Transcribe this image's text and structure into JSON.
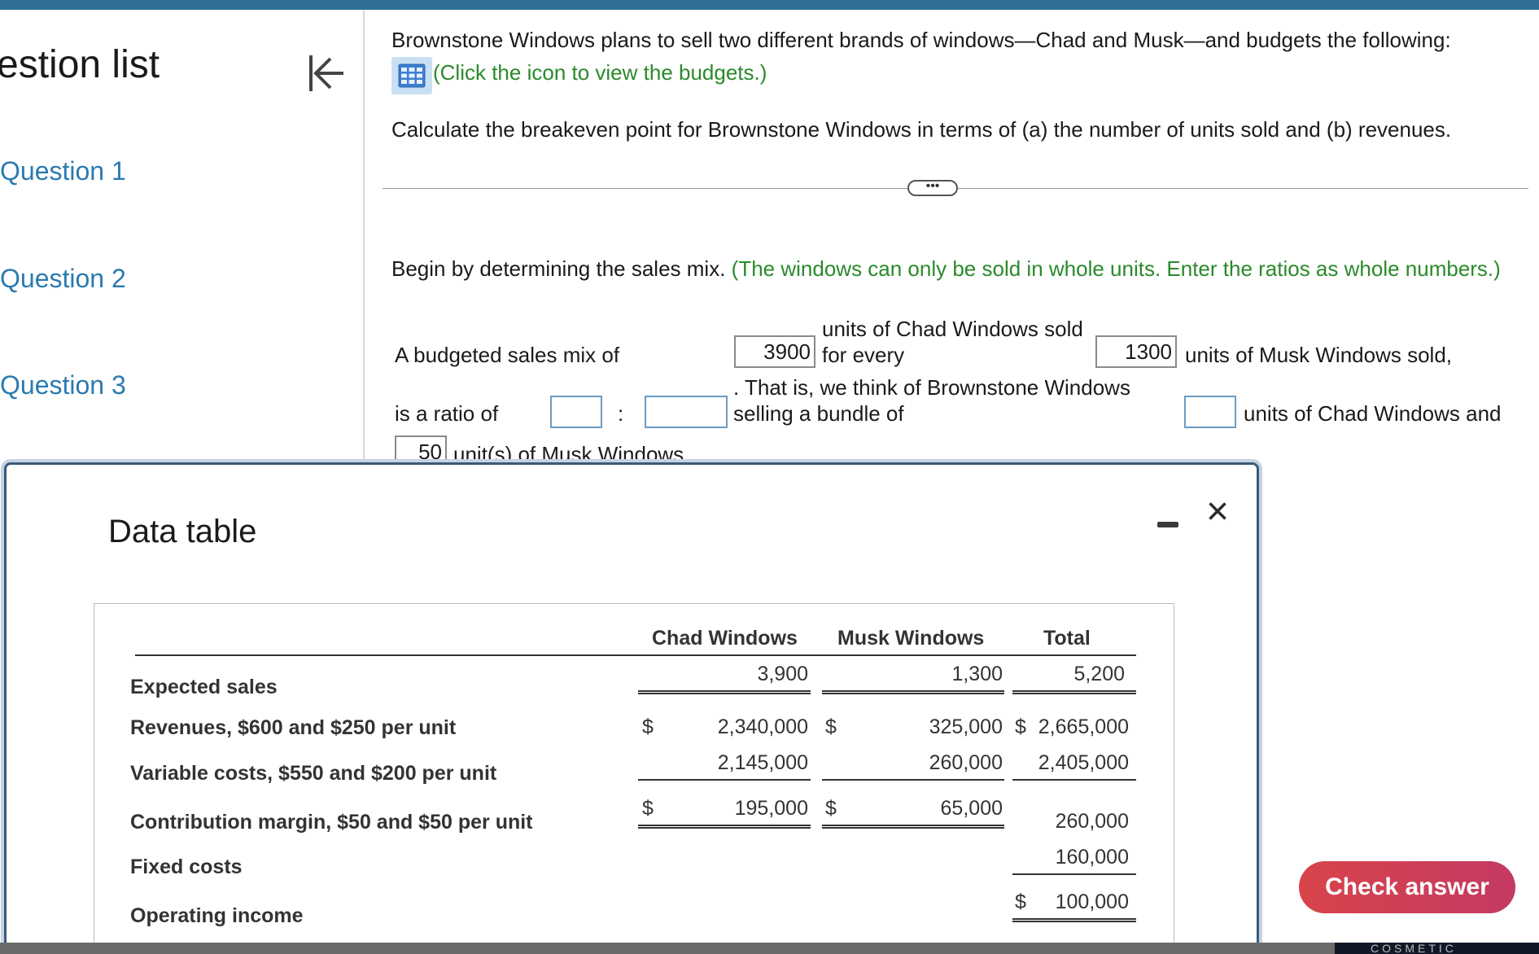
{
  "sidebar": {
    "title": "estion list",
    "items": [
      {
        "label": "Question 1"
      },
      {
        "label": "Question 2"
      },
      {
        "label": "Question 3"
      }
    ]
  },
  "question": {
    "intro": "Brownstone Windows plans to sell two different brands of windows—Chad and Musk—and budgets the following:",
    "budget_link": "(Click the icon to view the budgets.)",
    "task": "Calculate the breakeven point for Brownstone Windows in terms of (a) the number of units sold and (b) revenues.",
    "more_label": "•••",
    "step_text": "Begin by determining the sales mix.",
    "step_hint": "(The windows can only be sold in whole units. Enter the ratios as whole numbers.)"
  },
  "sentence": {
    "t1": "A budgeted sales mix of",
    "t2a": "units of Chad Windows sold",
    "t2b": "for every",
    "t3": "units of Musk Windows sold,",
    "t4": "is a ratio of",
    "colon": ":",
    "t5a": ". That is, we think of Brownstone Windows",
    "t5b": "selling a bundle of",
    "t6": "units of Chad Windows and",
    "t7": "unit(s) of Musk Windows."
  },
  "inputs": {
    "chad_units": "3900",
    "musk_units": "1300",
    "ratio_chad": "",
    "ratio_musk": "",
    "bundle_chad": "",
    "bundle_musk": "50"
  },
  "data_table": {
    "title": "Data table",
    "headers": [
      "Chad Windows",
      "Musk Windows",
      "Total"
    ],
    "rows": [
      {
        "label": "Expected sales",
        "chad": "3,900",
        "musk": "1,300",
        "total": "5,200"
      },
      {
        "label": "Revenues, $600 and $250 per unit",
        "chad": "2,340,000",
        "musk": "325,000",
        "total": "2,665,000"
      },
      {
        "label": "Variable costs, $550 and $200 per unit",
        "chad": "2,145,000",
        "musk": "260,000",
        "total": "2,405,000"
      },
      {
        "label": "Contribution margin, $50 and $50 per unit",
        "chad": "195,000",
        "musk": "65,000",
        "total": "260,000"
      },
      {
        "label": "Fixed costs",
        "chad": "",
        "musk": "",
        "total": "160,000"
      },
      {
        "label": "Operating income",
        "chad": "",
        "musk": "",
        "total": "100,000"
      }
    ],
    "currency": "$"
  },
  "actions": {
    "check_answer": "Check answer"
  },
  "footer": {
    "brand": "COSMETIC"
  },
  "colors": {
    "accent": "#2f6f94",
    "link": "#2a7ab0",
    "hint": "#2a8a2a",
    "check_button": "#d8444a"
  }
}
